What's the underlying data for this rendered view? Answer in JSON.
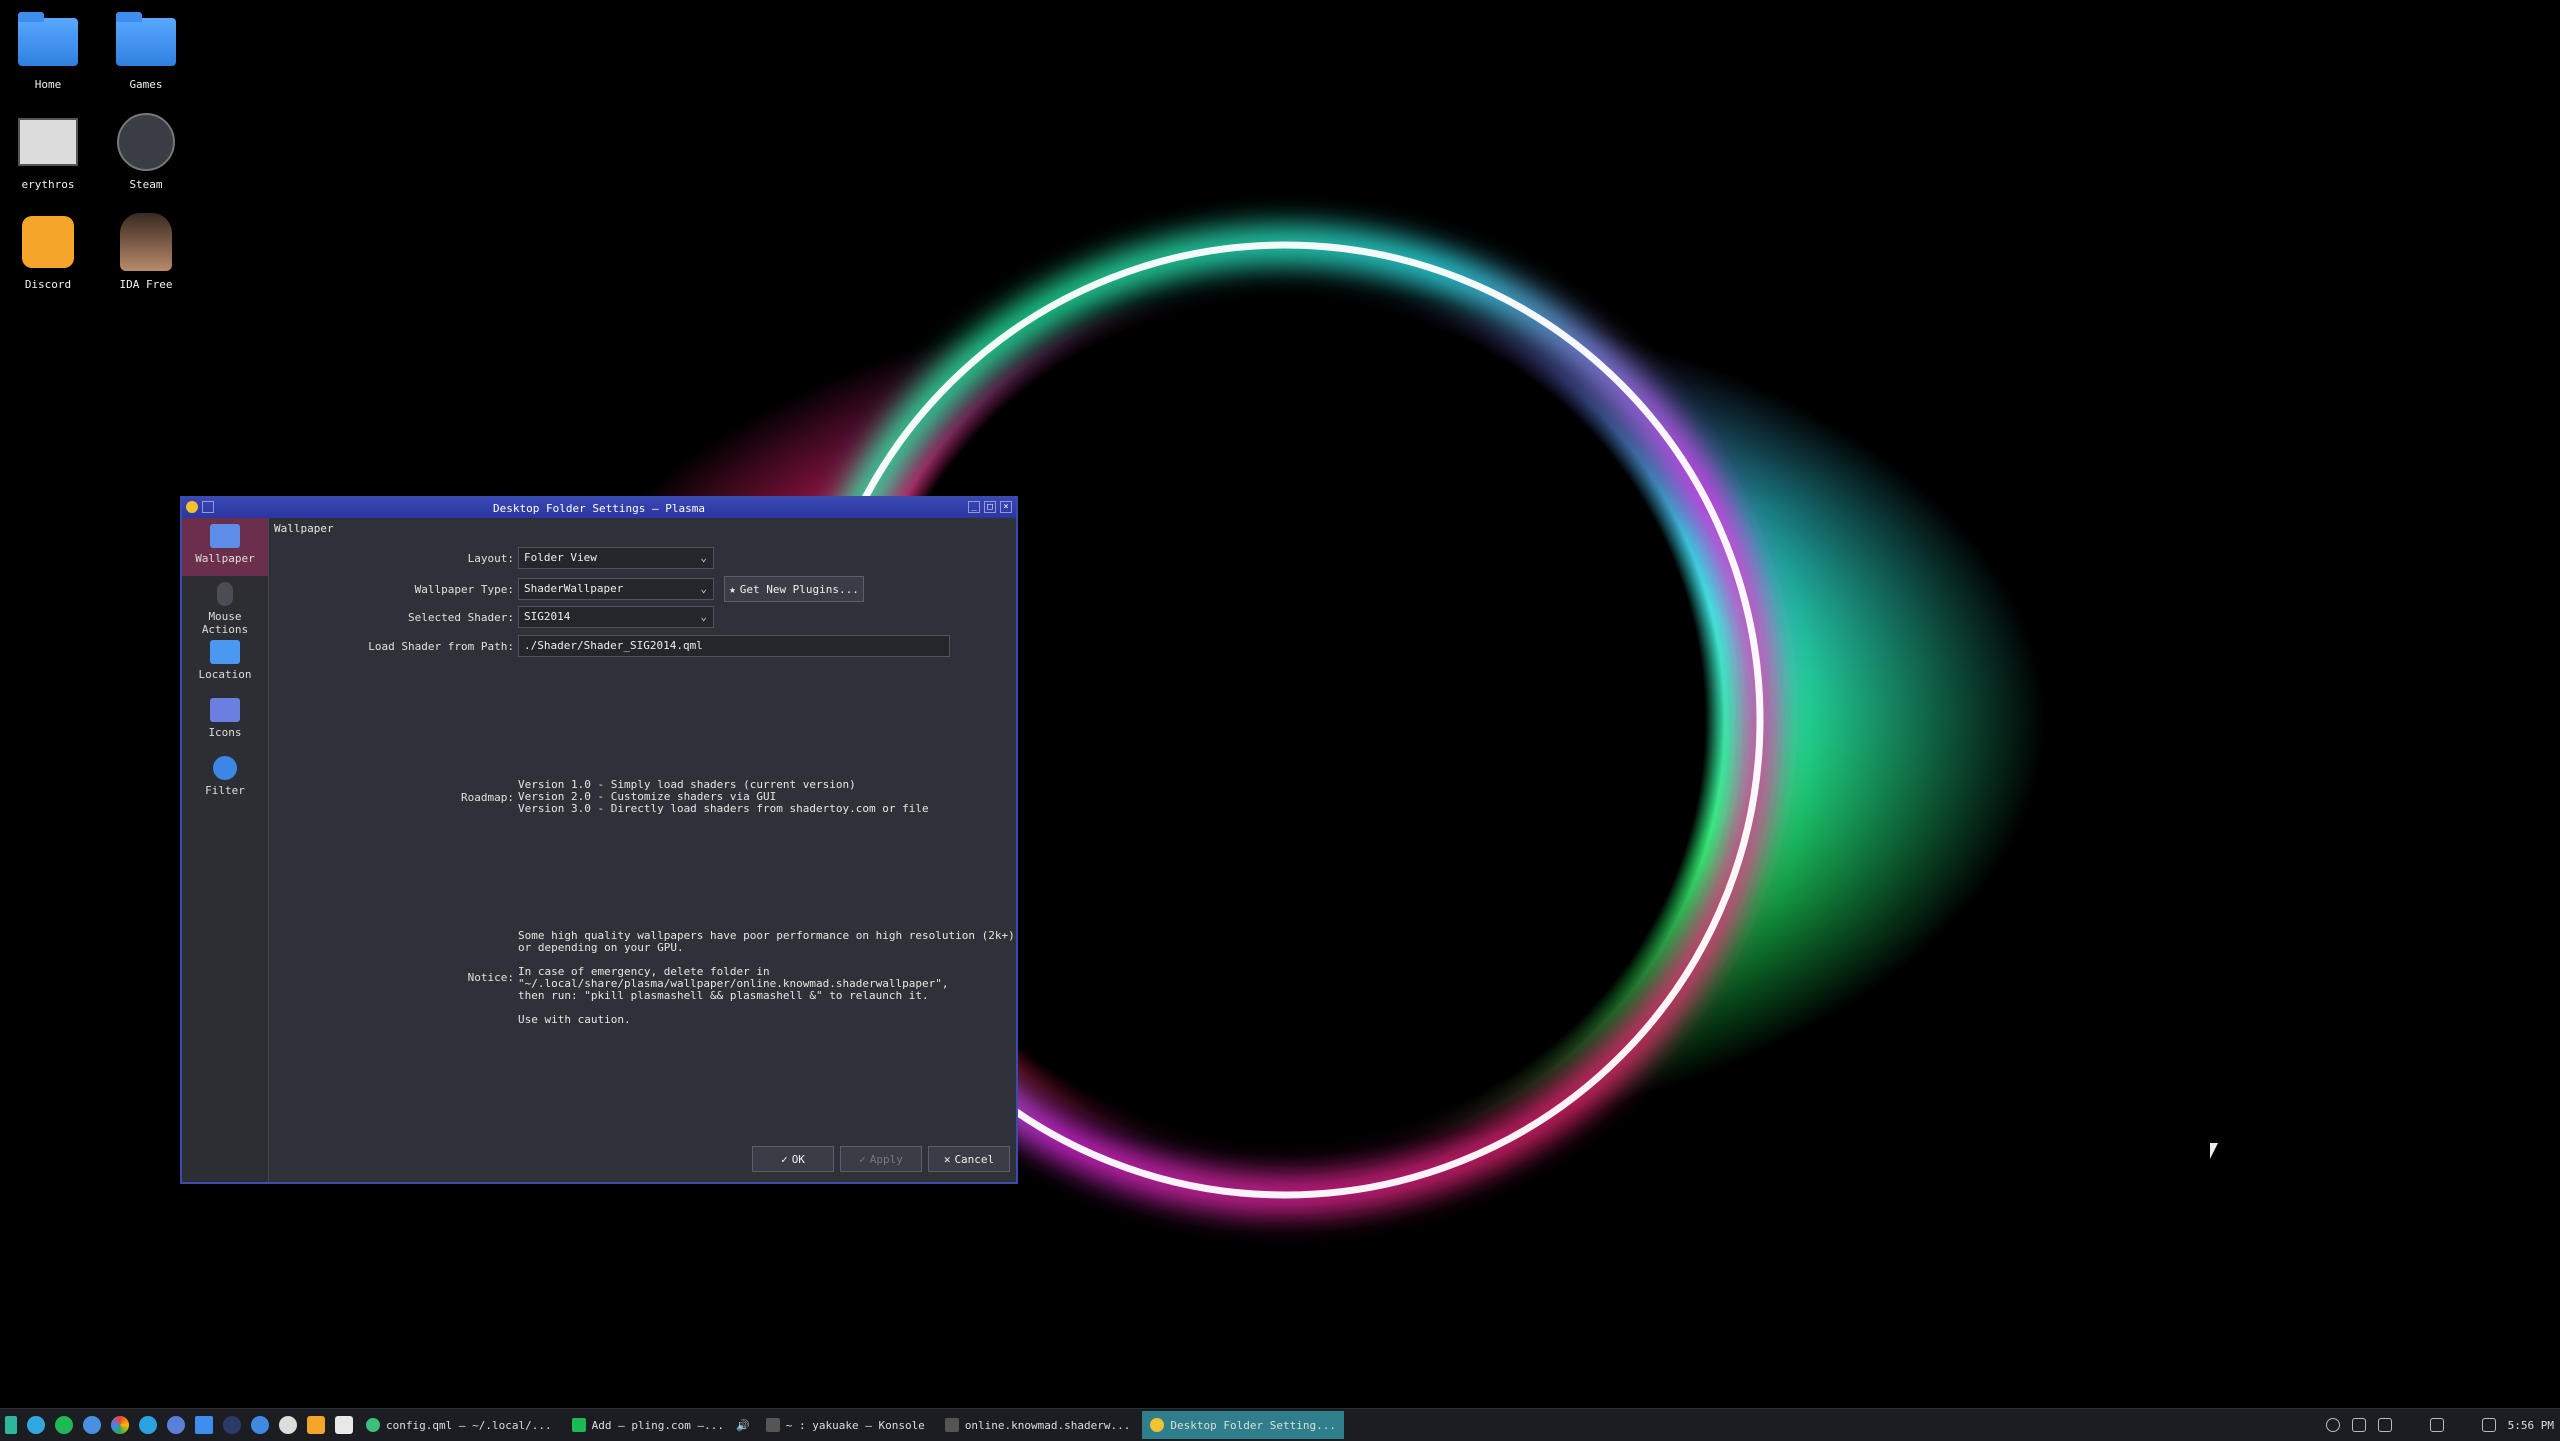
{
  "desktop": {
    "icons": [
      {
        "label": "Home",
        "icon": "folder-home-icon"
      },
      {
        "label": "Games",
        "icon": "folder-icon"
      },
      {
        "label": "erythros",
        "icon": "terminal-thumbnail-icon"
      },
      {
        "label": "Steam",
        "icon": "steam-icon"
      },
      {
        "label": "Discord",
        "icon": "discord-icon"
      },
      {
        "label": "IDA Free",
        "icon": "ida-free-icon"
      }
    ],
    "colors": {
      "ring_green": "#20ff6e",
      "ring_cyan": "#32f2ff",
      "ring_magenta": "#ee2cf0",
      "ring_red": "#ff2233"
    }
  },
  "dialog": {
    "title": "Desktop Folder Settings — Plasma",
    "sidebar": [
      {
        "label": "Wallpaper",
        "icon": "wallpaper-icon"
      },
      {
        "label": "Mouse Actions",
        "icon": "mouse-icon"
      },
      {
        "label": "Location",
        "icon": "location-folder-icon"
      },
      {
        "label": "Icons",
        "icon": "icons-grid-icon"
      },
      {
        "label": "Filter",
        "icon": "filter-icon"
      }
    ],
    "section_title": "Wallpaper",
    "layout": {
      "label": "Layout:",
      "value": "Folder View"
    },
    "wallpaper_type": {
      "label": "Wallpaper Type:",
      "value": "ShaderWallpaper"
    },
    "get_plugins": "Get New Plugins...",
    "selected_shader": {
      "label": "Selected Shader:",
      "value": "SIG2014"
    },
    "load_shader": {
      "label": "Load Shader from Path:",
      "value": "./Shader/Shader_SIG2014.qml"
    },
    "roadmap": {
      "label": "Roadmap:",
      "text": "Version 1.0 - Simply load shaders (current version)\nVersion 2.0 - Customize shaders via GUI\nVersion 3.0 - Directly load shaders from shadertoy.com or file"
    },
    "notice": {
      "label": "Notice:",
      "text": "Some high quality wallpapers have poor performance on high resolution (2k+)\nor depending on your GPU.\n\nIn case of emergency, delete folder in\n\"~/.local/share/plasma/wallpaper/online.knowmad.shaderwallpaper\",\nthen run: \"pkill plasmashell && plasmashell &\" to relaunch it.\n\nUse with caution."
    },
    "buttons": {
      "ok": "OK",
      "apply": "Apply",
      "cancel": "Cancel"
    },
    "accent": "#3c4bb0"
  },
  "taskbar": {
    "tasks": [
      {
        "label": "config.qml — ~/.local/..."
      },
      {
        "label": "Add — pling.com —..."
      },
      {
        "label": "~ : yakuake — Konsole"
      },
      {
        "label": "online.knowmad.shaderw..."
      },
      {
        "label": "Desktop Folder Setting..."
      }
    ],
    "clock": "5:56 PM"
  }
}
